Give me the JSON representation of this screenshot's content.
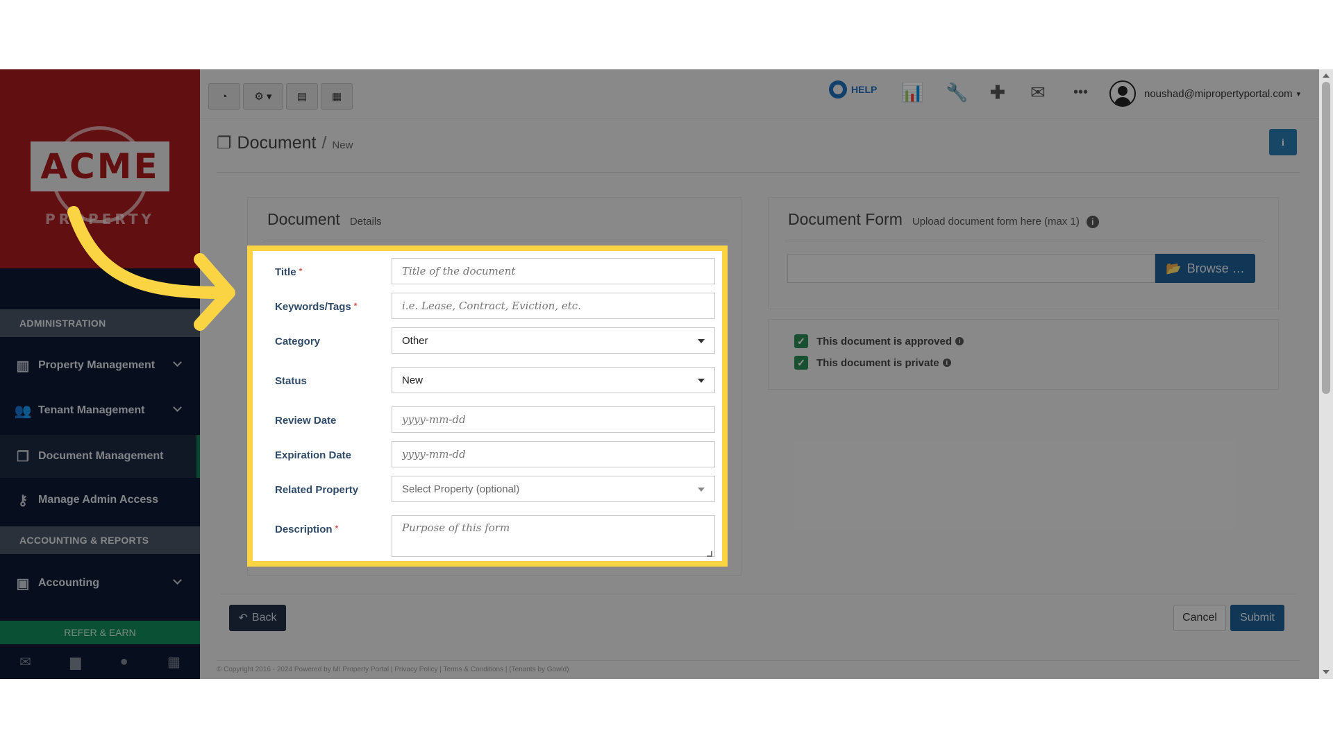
{
  "sidebar": {
    "logo_text": "ACME",
    "logo_sub": "PROPERTY",
    "section_admin": "ADMINISTRATION",
    "section_accounting": "ACCOUNTING & REPORTS",
    "items": [
      {
        "label": "Property Management",
        "icon": "building-icon"
      },
      {
        "label": "Tenant Management",
        "icon": "users-icon"
      },
      {
        "label": "Document Management",
        "icon": "documents-icon"
      },
      {
        "label": "Manage Admin Access",
        "icon": "key-icon"
      },
      {
        "label": "Accounting",
        "icon": "money-icon"
      }
    ],
    "refer_label": "REFER & EARN"
  },
  "topbar": {
    "help_label": "HELP",
    "user_email": "noushad@mipropertyportal.com"
  },
  "breadcrumb": {
    "title": "Document",
    "separator": "/",
    "sub": "New"
  },
  "details_panel": {
    "title": "Document",
    "subtitle": "Details"
  },
  "form": {
    "title_label": "Title",
    "title_placeholder": "Title of the document",
    "keywords_label": "Keywords/Tags",
    "keywords_placeholder": "i.e. Lease, Contract, Eviction, etc.",
    "category_label": "Category",
    "category_value": "Other",
    "status_label": "Status",
    "status_value": "New",
    "review_label": "Review Date",
    "review_placeholder": "yyyy-mm-dd",
    "expiration_label": "Expiration Date",
    "expiration_placeholder": "yyyy-mm-dd",
    "property_label": "Related Property",
    "property_value": "Select Property (optional)",
    "description_label": "Description",
    "description_placeholder": "Purpose of this form",
    "required_mark": "*"
  },
  "upload_panel": {
    "title": "Document Form",
    "subtitle": "Upload document form here (max 1)",
    "browse_label": "Browse …"
  },
  "flags": {
    "approved_label": "This document is approved",
    "private_label": "This document is private"
  },
  "actions": {
    "back_label": "Back",
    "cancel_label": "Cancel",
    "submit_label": "Submit"
  },
  "footer": {
    "copyright": "© Copyright 2016 - 2024 Powered by MI Property Portal | Privacy Policy | Terms & Conditions | (Tenants by Gowld)"
  },
  "colors": {
    "highlight": "#fbd444",
    "brand_red": "#a81a1e",
    "sidebar_bg": "#0d1a34",
    "primary_blue": "#1f5d94",
    "success_green": "#2e8b57"
  }
}
